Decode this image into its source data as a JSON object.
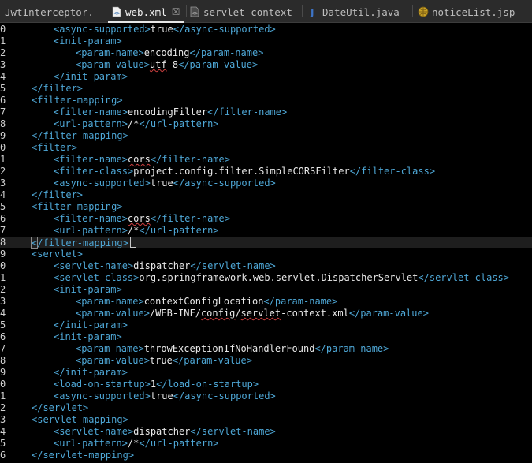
{
  "tabs": [
    {
      "label": "JwtInterceptor.",
      "icon": "none",
      "active": false
    },
    {
      "label": "web.xml",
      "icon": "xml-file-icon",
      "active": true,
      "close": "☒"
    },
    {
      "label": "servlet-context",
      "icon": "xml-file-icon",
      "active": false
    },
    {
      "label": "DateUtil.java",
      "icon": "java-file-icon",
      "active": false
    },
    {
      "label": "noticeList.jsp",
      "icon": "jsp-file-icon",
      "active": false
    }
  ],
  "lines": [
    {
      "n": "0",
      "indent": 2,
      "parts": [
        [
          "tag",
          "<async-supported>"
        ],
        [
          "txt",
          "true"
        ],
        [
          "tag",
          "</async-supported>"
        ]
      ]
    },
    {
      "n": "1",
      "indent": 2,
      "parts": [
        [
          "tag",
          "<init-param>"
        ]
      ]
    },
    {
      "n": "2",
      "indent": 3,
      "parts": [
        [
          "tag",
          "<param-name>"
        ],
        [
          "txt",
          "encoding"
        ],
        [
          "tag",
          "</param-name>"
        ]
      ]
    },
    {
      "n": "3",
      "indent": 3,
      "parts": [
        [
          "tag",
          "<param-value>"
        ],
        [
          "sq",
          "utf"
        ],
        [
          "txt",
          "-8"
        ],
        [
          "tag",
          "</param-value>"
        ]
      ]
    },
    {
      "n": "4",
      "indent": 2,
      "parts": [
        [
          "tag",
          "</init-param>"
        ]
      ]
    },
    {
      "n": "5",
      "indent": 1,
      "parts": [
        [
          "tag",
          "</filter>"
        ]
      ]
    },
    {
      "n": "6",
      "indent": 1,
      "parts": [
        [
          "tag",
          "<filter-mapping>"
        ]
      ]
    },
    {
      "n": "7",
      "indent": 2,
      "parts": [
        [
          "tag",
          "<filter-name>"
        ],
        [
          "txt",
          "encodingFilter"
        ],
        [
          "tag",
          "</filter-name>"
        ]
      ]
    },
    {
      "n": "8",
      "indent": 2,
      "parts": [
        [
          "tag",
          "<url-pattern>"
        ],
        [
          "txt",
          "/*"
        ],
        [
          "tag",
          "</url-pattern>"
        ]
      ]
    },
    {
      "n": "9",
      "indent": 1,
      "parts": [
        [
          "tag",
          "</filter-mapping>"
        ]
      ]
    },
    {
      "n": "0",
      "indent": 1,
      "parts": [
        [
          "tag",
          "<filter>"
        ]
      ]
    },
    {
      "n": "1",
      "indent": 2,
      "parts": [
        [
          "tag",
          "<filter-name>"
        ],
        [
          "sq",
          "cors"
        ],
        [
          "tag",
          "</filter-name>"
        ]
      ]
    },
    {
      "n": "2",
      "indent": 2,
      "parts": [
        [
          "tag",
          "<filter-class>"
        ],
        [
          "txt",
          "project.config.filter.SimpleCORSFilter"
        ],
        [
          "tag",
          "</filter-class>"
        ]
      ]
    },
    {
      "n": "3",
      "indent": 2,
      "parts": [
        [
          "tag",
          "<async-supported>"
        ],
        [
          "txt",
          "true"
        ],
        [
          "tag",
          "</async-supported>"
        ]
      ]
    },
    {
      "n": "4",
      "indent": 1,
      "parts": [
        [
          "tag",
          "</filter>"
        ]
      ]
    },
    {
      "n": "5",
      "indent": 1,
      "parts": [
        [
          "tag",
          "<filter-mapping>"
        ]
      ]
    },
    {
      "n": "6",
      "indent": 2,
      "parts": [
        [
          "tag",
          "<filter-name>"
        ],
        [
          "sq",
          "cors"
        ],
        [
          "tag",
          "</filter-name>"
        ]
      ]
    },
    {
      "n": "7",
      "indent": 2,
      "parts": [
        [
          "tag",
          "<url-pattern>"
        ],
        [
          "txt",
          "/*"
        ],
        [
          "tag",
          "</url-pattern>"
        ]
      ]
    },
    {
      "n": "8",
      "indent": 1,
      "current": true,
      "parts": [
        [
          "hl",
          "<"
        ],
        [
          "tag",
          "/filter-mapping>"
        ],
        [
          "caret",
          ""
        ]
      ]
    },
    {
      "n": "9",
      "indent": 1,
      "parts": [
        [
          "tag",
          "<servlet>"
        ]
      ]
    },
    {
      "n": "0",
      "indent": 2,
      "parts": [
        [
          "tag",
          "<servlet-name>"
        ],
        [
          "txt",
          "dispatcher"
        ],
        [
          "tag",
          "</servlet-name>"
        ]
      ]
    },
    {
      "n": "1",
      "indent": 2,
      "parts": [
        [
          "tag",
          "<servlet-class>"
        ],
        [
          "txt",
          "org.springframework.web.servlet.DispatcherServlet"
        ],
        [
          "tag",
          "</servlet-class>"
        ]
      ]
    },
    {
      "n": "2",
      "indent": 2,
      "parts": [
        [
          "tag",
          "<init-param>"
        ]
      ]
    },
    {
      "n": "3",
      "indent": 3,
      "parts": [
        [
          "tag",
          "<param-name>"
        ],
        [
          "txt",
          "contextConfigLocation"
        ],
        [
          "tag",
          "</param-name>"
        ]
      ]
    },
    {
      "n": "4",
      "indent": 3,
      "parts": [
        [
          "tag",
          "<param-value>"
        ],
        [
          "txt",
          "/WEB-INF/"
        ],
        [
          "sq",
          "config"
        ],
        [
          "txt",
          "/"
        ],
        [
          "sq",
          "servlet"
        ],
        [
          "txt",
          "-context.xml"
        ],
        [
          "tag",
          "</param-value>"
        ]
      ]
    },
    {
      "n": "5",
      "indent": 2,
      "parts": [
        [
          "tag",
          "</init-param>"
        ]
      ]
    },
    {
      "n": "6",
      "indent": 2,
      "parts": [
        [
          "tag",
          "<init-param>"
        ]
      ]
    },
    {
      "n": "7",
      "indent": 3,
      "parts": [
        [
          "tag",
          "<param-name>"
        ],
        [
          "txt",
          "throwExceptionIfNoHandlerFound"
        ],
        [
          "tag",
          "</param-name>"
        ]
      ]
    },
    {
      "n": "8",
      "indent": 3,
      "parts": [
        [
          "tag",
          "<param-value>"
        ],
        [
          "txt",
          "true"
        ],
        [
          "tag",
          "</param-value>"
        ]
      ]
    },
    {
      "n": "9",
      "indent": 2,
      "parts": [
        [
          "tag",
          "</init-param>"
        ]
      ]
    },
    {
      "n": "0",
      "indent": 2,
      "parts": [
        [
          "tag",
          "<load-on-startup>"
        ],
        [
          "txt",
          "1"
        ],
        [
          "tag",
          "</load-on-startup>"
        ]
      ]
    },
    {
      "n": "1",
      "indent": 2,
      "parts": [
        [
          "tag",
          "<async-supported>"
        ],
        [
          "txt",
          "true"
        ],
        [
          "tag",
          "</async-supported>"
        ]
      ]
    },
    {
      "n": "2",
      "indent": 1,
      "parts": [
        [
          "tag",
          "</servlet>"
        ]
      ]
    },
    {
      "n": "3",
      "indent": 1,
      "parts": [
        [
          "tag",
          "<servlet-mapping>"
        ]
      ]
    },
    {
      "n": "4",
      "indent": 2,
      "parts": [
        [
          "tag",
          "<servlet-name>"
        ],
        [
          "txt",
          "dispatcher"
        ],
        [
          "tag",
          "</servlet-name>"
        ]
      ]
    },
    {
      "n": "5",
      "indent": 2,
      "parts": [
        [
          "tag",
          "<url-pattern>"
        ],
        [
          "txt",
          "/*"
        ],
        [
          "tag",
          "</url-pattern>"
        ]
      ]
    },
    {
      "n": "6",
      "indent": 1,
      "parts": [
        [
          "tag",
          "</servlet-mapping>"
        ]
      ]
    }
  ],
  "colors": {
    "tag": "#4ea7d6",
    "text": "#e8e8e8",
    "spell_error": "#d04040",
    "background": "#000000"
  }
}
